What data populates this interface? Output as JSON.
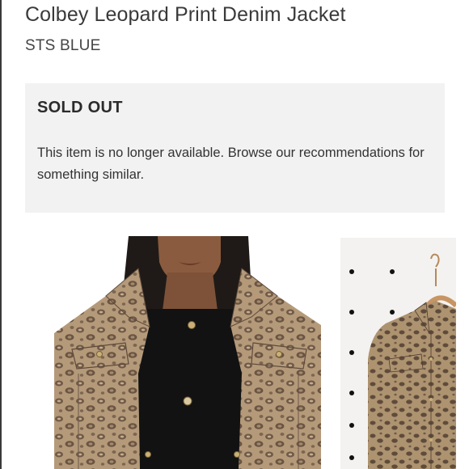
{
  "product": {
    "title": "Colbey Leopard Print Denim Jacket",
    "brand": "STS BLUE"
  },
  "availability": {
    "heading": "SOLD OUT",
    "message": "This item is no longer available. Browse our recommendations for something similar."
  },
  "images": [
    {
      "name": "model-wearing-jacket-photo"
    },
    {
      "name": "jacket-on-hanger-photo"
    }
  ],
  "colors": {
    "leopard_base": "#b59a7a",
    "leopard_spot": "#6f5a48",
    "notice_bg": "#f2f2f2"
  }
}
